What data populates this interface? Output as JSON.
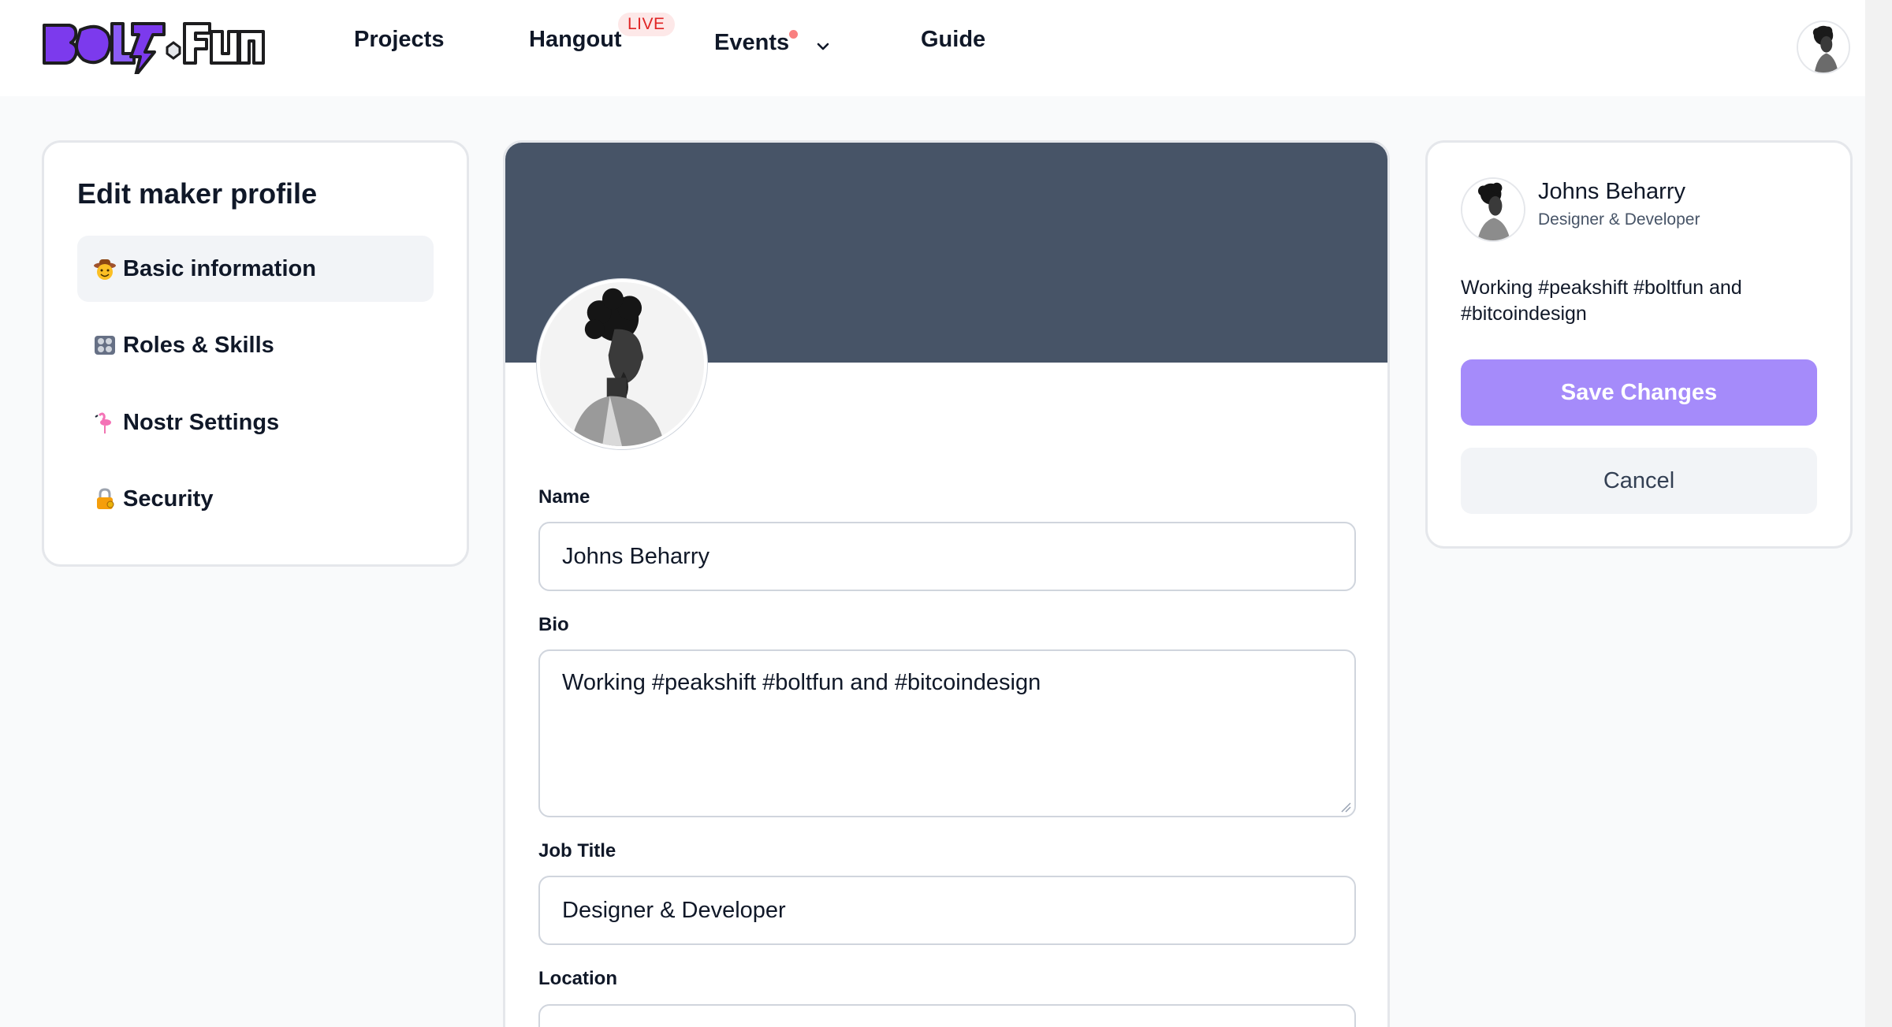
{
  "nav": {
    "logo_text": "BOLT.FUN",
    "links": {
      "projects": "Projects",
      "hangout": "Hangout",
      "live_badge": "LIVE",
      "events": "Events",
      "guide": "Guide"
    }
  },
  "sidebar": {
    "title": "Edit maker profile",
    "items": [
      {
        "label": "Basic information",
        "icon": "cowboy-emoji-icon",
        "active": true
      },
      {
        "label": "Roles & Skills",
        "icon": "control-knobs-emoji-icon",
        "active": false
      },
      {
        "label": "Nostr Settings",
        "icon": "flamingo-emoji-icon",
        "active": false
      },
      {
        "label": "Security",
        "icon": "lock-key-emoji-icon",
        "active": false
      }
    ]
  },
  "form": {
    "name_label": "Name",
    "name_value": "Johns Beharry",
    "bio_label": "Bio",
    "bio_value": "Working #peakshift #boltfun and #bitcoindesign",
    "job_label": "Job Title",
    "job_value": "Designer & Developer",
    "location_label": "Location",
    "location_value": ""
  },
  "preview": {
    "name": "Johns Beharry",
    "role": "Designer & Developer",
    "bio": "Working #peakshift #boltfun and #bitcoindesign",
    "save_label": "Save Changes",
    "cancel_label": "Cancel"
  },
  "colors": {
    "cover": "#475467",
    "primary": "#a58bfa",
    "live": "#e02424"
  }
}
